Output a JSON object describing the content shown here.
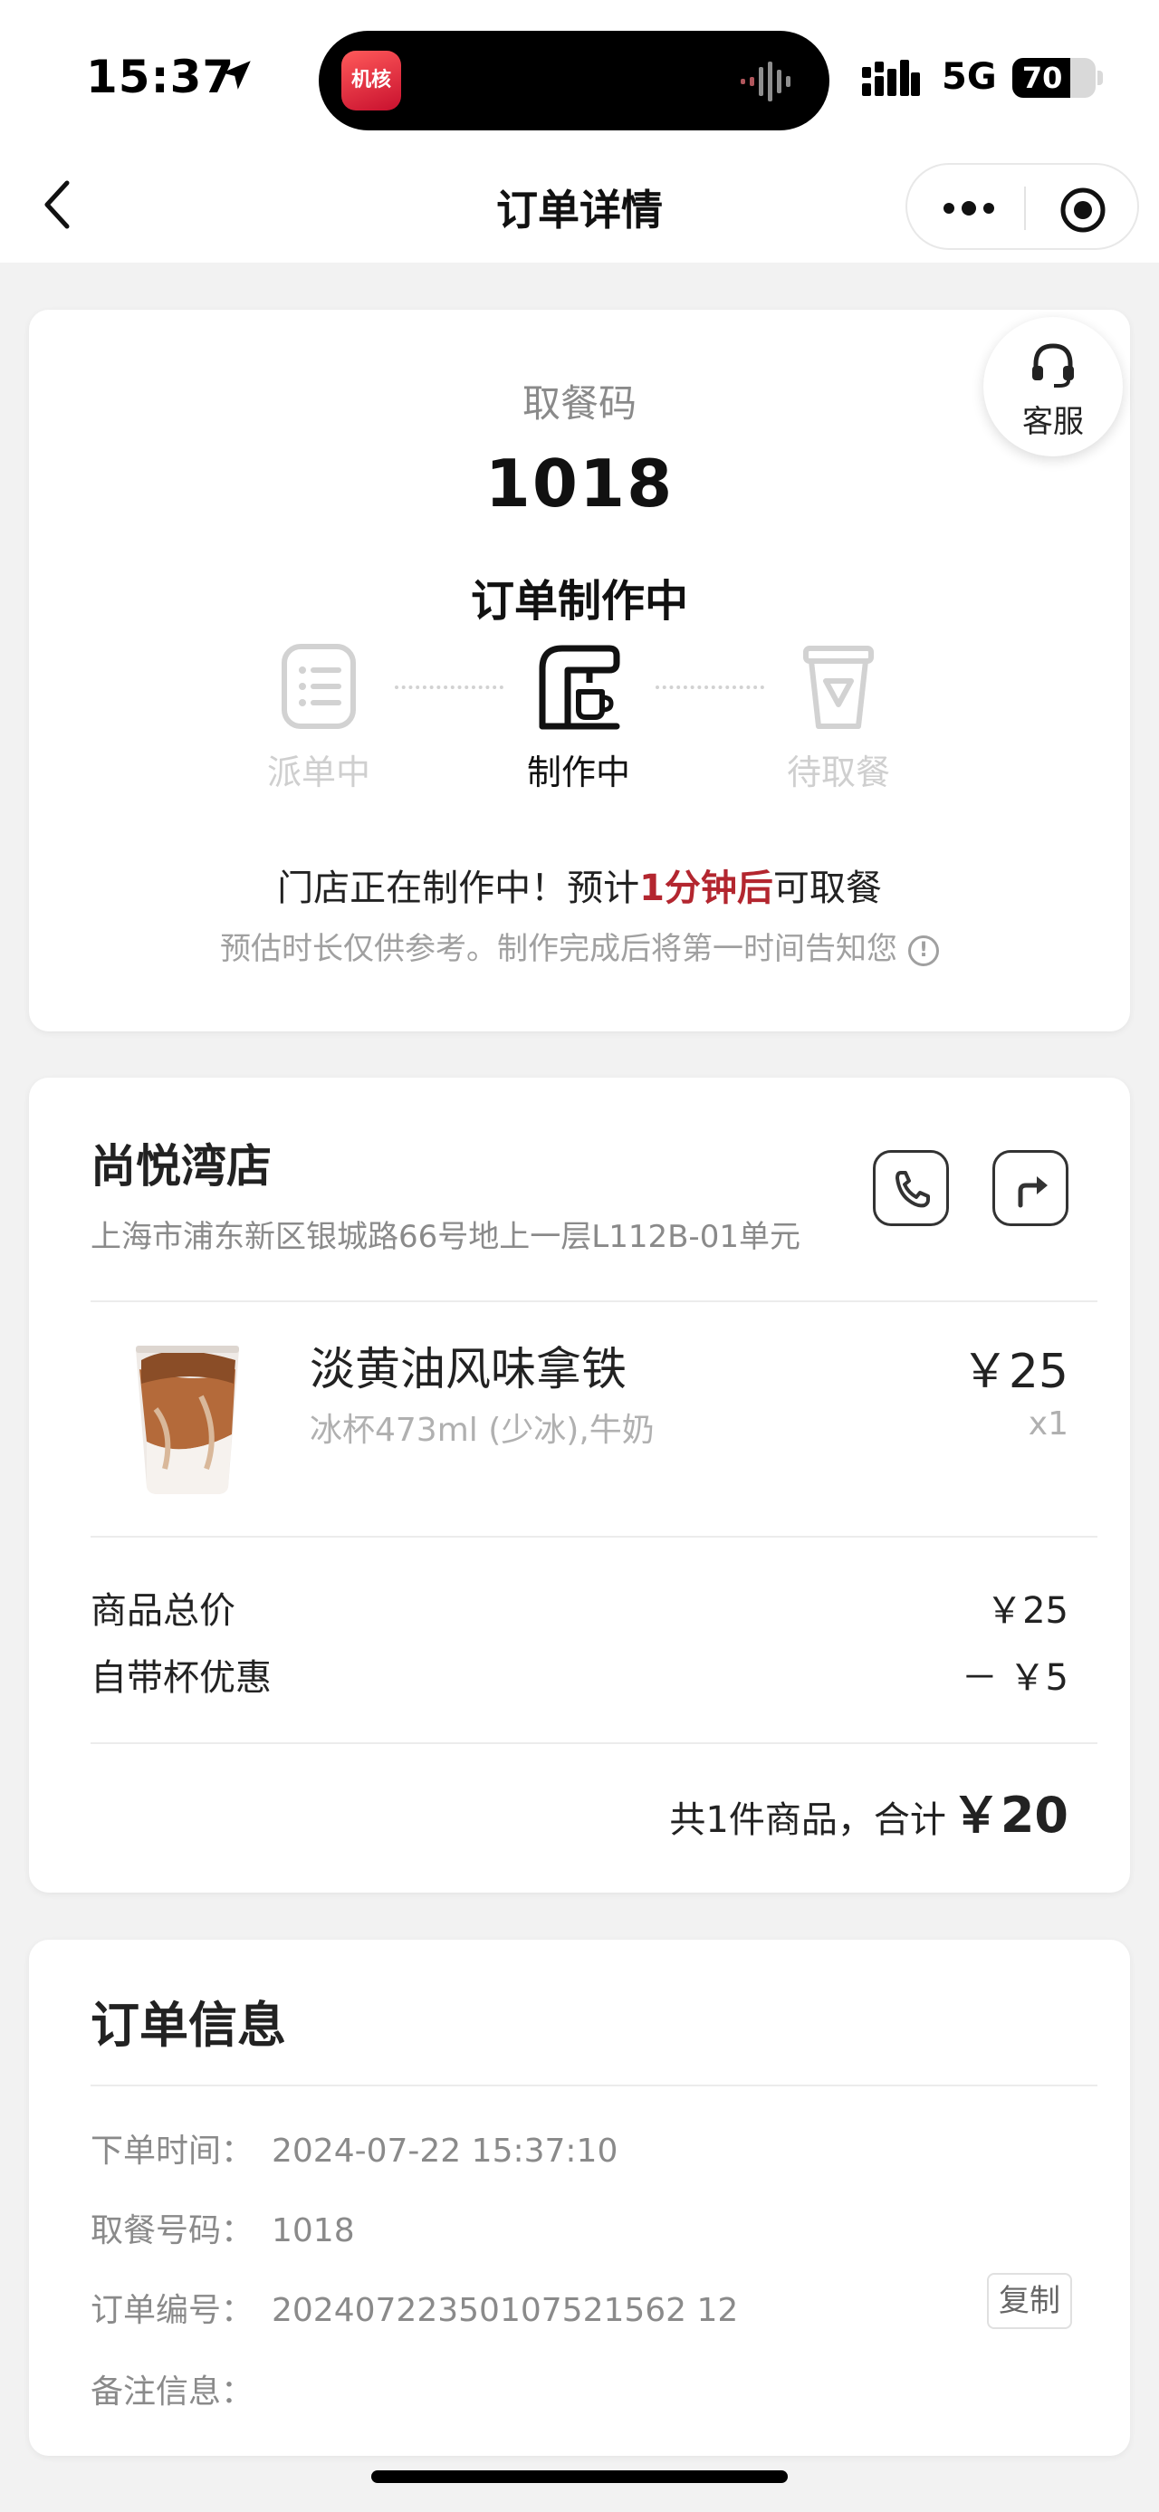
{
  "status_bar": {
    "time": "15:37",
    "network": "5G",
    "battery": "70",
    "battery_level": 0.7,
    "island_app_label": "机核"
  },
  "header": {
    "title": "订单详情"
  },
  "pickup": {
    "label": "取餐码",
    "code": "1018",
    "status": "订单制作中",
    "customer_service": "客服",
    "steps": [
      {
        "label": "派单中",
        "state": "done"
      },
      {
        "label": "制作中",
        "state": "active"
      },
      {
        "label": "待取餐",
        "state": "pending"
      }
    ],
    "notice_prefix": "门店正在制作中！预计",
    "notice_highlight": "1分钟后",
    "notice_suffix": "可取餐",
    "subnotice": "预估时长仅供参考。制作完成后将第一时间告知您",
    "highlight_color": "#b3262f"
  },
  "store": {
    "name": "尚悦湾店",
    "address": "上海市浦东新区银城路66号地上一层L112B-01单元"
  },
  "product": {
    "name": "淡黄油风味拿铁",
    "spec": "冰杯473ml (少冰),牛奶",
    "price": "￥25",
    "qty": "x1"
  },
  "summary": {
    "subtotal_label": "商品总价",
    "subtotal_value": "￥25",
    "discount_label": "自带杯优惠",
    "discount_value": "－ ￥5",
    "total_prefix": "共1件商品，合计",
    "total_amount": "￥20"
  },
  "order_info": {
    "title": "订单信息",
    "rows": [
      {
        "key": "下单时间：",
        "value": "2024-07-22 15:37:10"
      },
      {
        "key": "取餐号码：",
        "value": "1018"
      },
      {
        "key": "订单编号：",
        "value": "20240722350107521562 12"
      },
      {
        "key": "备注信息：",
        "value": ""
      }
    ],
    "copy_label": "复制"
  }
}
